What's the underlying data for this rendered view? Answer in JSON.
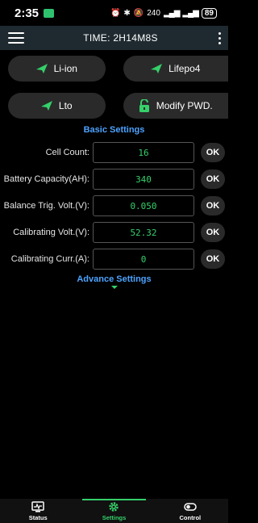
{
  "status_bar": {
    "time": "2:35",
    "right_glyphs": "⏰ ✱ ⚇",
    "speed": "240",
    "battery": "89"
  },
  "app_bar": {
    "title": "TIME: 2H14M8S"
  },
  "mode_buttons": [
    {
      "label": "Li-ion",
      "icon": "send-plane-icon"
    },
    {
      "label": "Lifepo4",
      "icon": "send-plane-icon"
    },
    {
      "label": "Lto",
      "icon": "send-plane-icon"
    },
    {
      "label": "Modify PWD.",
      "icon": "lock-open-icon"
    }
  ],
  "basic_settings": {
    "title": "Basic Settings",
    "rows": [
      {
        "label": "Cell Count:",
        "value": "16",
        "action": "OK"
      },
      {
        "label": "Battery Capacity(AH):",
        "value": "340",
        "action": "OK"
      },
      {
        "label": "Balance Trig. Volt.(V):",
        "value": "0.050",
        "action": "OK"
      },
      {
        "label": "Calibrating Volt.(V):",
        "value": "52.32",
        "action": "OK"
      },
      {
        "label": "Calibrating Curr.(A):",
        "value": "0",
        "action": "OK"
      }
    ]
  },
  "advance_settings": {
    "title": "Advance Settings"
  },
  "bottom_nav": [
    {
      "label": "Status",
      "icon": "monitor-icon",
      "active": false
    },
    {
      "label": "Settings",
      "icon": "gear-icon",
      "active": true
    },
    {
      "label": "Control",
      "icon": "toggle-icon",
      "active": false
    }
  ],
  "colors": {
    "accent_green": "#35d06a",
    "accent_blue": "#4ea3ff",
    "app_bar_bg": "#1f2a30"
  }
}
